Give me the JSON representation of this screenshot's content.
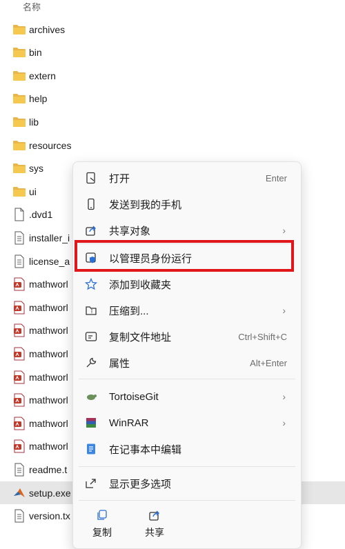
{
  "explorer": {
    "column_name": "名称",
    "files": [
      {
        "name": "archives",
        "icon": "folder-icon"
      },
      {
        "name": "bin",
        "icon": "folder-icon"
      },
      {
        "name": "extern",
        "icon": "folder-icon"
      },
      {
        "name": "help",
        "icon": "folder-icon"
      },
      {
        "name": "lib",
        "icon": "folder-icon"
      },
      {
        "name": "resources",
        "icon": "folder-icon"
      },
      {
        "name": "sys",
        "icon": "folder-icon"
      },
      {
        "name": "ui",
        "icon": "folder-icon"
      },
      {
        "name": ".dvd1",
        "icon": "blank-file-icon"
      },
      {
        "name": "installer_i",
        "icon": "text-file-icon"
      },
      {
        "name": "license_a",
        "icon": "text-file-icon"
      },
      {
        "name": "mathworl",
        "icon": "archive-file-icon"
      },
      {
        "name": "mathworl",
        "icon": "archive-file-icon"
      },
      {
        "name": "mathworl",
        "icon": "archive-file-icon"
      },
      {
        "name": "mathworl",
        "icon": "archive-file-icon"
      },
      {
        "name": "mathworl",
        "icon": "archive-file-icon"
      },
      {
        "name": "mathworl",
        "icon": "archive-file-icon"
      },
      {
        "name": "mathworl",
        "icon": "archive-file-icon"
      },
      {
        "name": "mathworl",
        "icon": "archive-file-icon"
      },
      {
        "name": "readme.t",
        "icon": "text-file-icon"
      },
      {
        "name": "setup.exe",
        "icon": "matlab-setup-icon",
        "selected": true
      },
      {
        "name": "version.tx",
        "icon": "text-file-icon"
      }
    ]
  },
  "context_menu": {
    "open": {
      "label": "打开",
      "shortcut": "Enter"
    },
    "send_to_phone": {
      "label": "发送到我的手机"
    },
    "share_with": {
      "label": "共享对象"
    },
    "run_as_admin": {
      "label": "以管理员身份运行"
    },
    "add_to_favorites": {
      "label": "添加到收藏夹"
    },
    "compress_to": {
      "label": "压缩到..."
    },
    "copy_path": {
      "label": "复制文件地址",
      "shortcut": "Ctrl+Shift+C"
    },
    "properties": {
      "label": "属性",
      "shortcut": "Alt+Enter"
    },
    "tortoisegit": {
      "label": "TortoiseGit"
    },
    "winrar": {
      "label": "WinRAR"
    },
    "edit_in_notepad": {
      "label": "在记事本中编辑"
    },
    "show_more_options": {
      "label": "显示更多选项"
    },
    "copy_button": {
      "label": "复制"
    },
    "share_button": {
      "label": "共享"
    }
  },
  "colors": {
    "highlight_border": "#e0161a",
    "folder": "#e8b64a",
    "selected_row": "#e6e6e6"
  }
}
